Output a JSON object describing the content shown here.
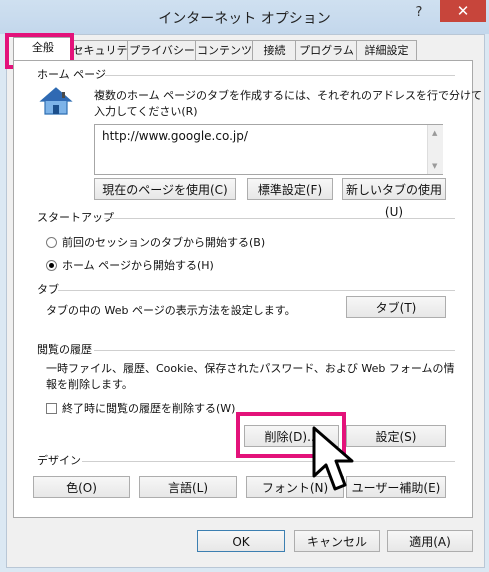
{
  "window": {
    "title": "インターネット オプション",
    "help_label": "?",
    "close_label": "✕"
  },
  "tabs": [
    {
      "label": "全般"
    },
    {
      "label": "セキュリティ"
    },
    {
      "label": "プライバシー"
    },
    {
      "label": "コンテンツ"
    },
    {
      "label": "接続"
    },
    {
      "label": "プログラム"
    },
    {
      "label": "詳細設定"
    }
  ],
  "homepage": {
    "header": "ホーム ページ",
    "description_line1": "複数のホーム ページのタブを作成するには、それぞれのアドレスを行で分けて",
    "description_line2": "入力してください(R)",
    "url": "http://www.google.co.jp/",
    "buttons": [
      "現在のページを使用(C)",
      "標準設定(F)",
      "新しいタブの使用(U)"
    ]
  },
  "startup": {
    "header": "スタートアップ",
    "options": [
      {
        "label": "前回のセッションのタブから開始する(B)",
        "selected": false
      },
      {
        "label": "ホーム ページから開始する(H)",
        "selected": true
      }
    ]
  },
  "tabs_section": {
    "header": "タブ",
    "description": "タブの中の Web ページの表示方法を設定します。",
    "button": "タブ(T)"
  },
  "history": {
    "header": "閲覧の履歴",
    "description_line1": "一時ファイル、履歴、Cookie、保存されたパスワード、および Web フォームの情",
    "description_line2": "報を削除します。",
    "checkbox_label": "終了時に閲覧の履歴を削除する(W)",
    "delete_button": "削除(D)...",
    "settings_button": "設定(S)"
  },
  "design": {
    "header": "デザイン",
    "buttons": [
      "色(O)",
      "言語(L)",
      "フォント(N)",
      "ユーザー補助(E)"
    ]
  },
  "footer": {
    "ok": "OK",
    "cancel": "キャンセル",
    "apply": "適用(A)"
  },
  "colors": {
    "accent_highlight": "#e3127a",
    "title_bar": "#cfe0f0",
    "close_button": "#c7453b"
  },
  "icons": {
    "home": "home-icon",
    "cursor": "mouse-cursor-icon"
  }
}
